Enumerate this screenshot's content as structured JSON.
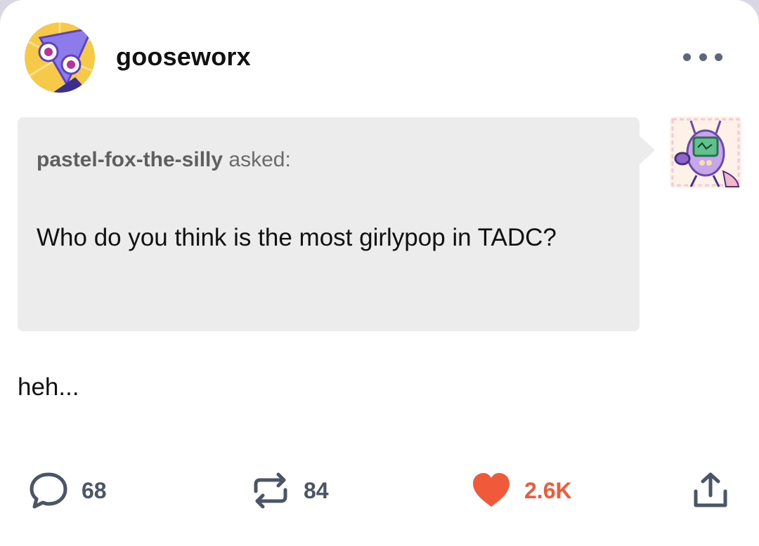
{
  "post": {
    "username": "gooseworx",
    "ask": {
      "asker": "pastel-fox-the-silly",
      "asked_label": "asked:",
      "question": "Who do you think is the most girlypop in TADC?"
    },
    "answer": "heh..."
  },
  "actions": {
    "replies": "68",
    "reblogs": "84",
    "likes": "2.6K"
  },
  "icons": {
    "more": "more-options-icon",
    "reply": "reply-bubble-icon",
    "reblog": "reblog-icon",
    "like": "heart-icon",
    "share": "share-icon"
  },
  "colors": {
    "like": "#f05a3b",
    "action_text": "#4a5565",
    "ask_background": "#ececec"
  }
}
